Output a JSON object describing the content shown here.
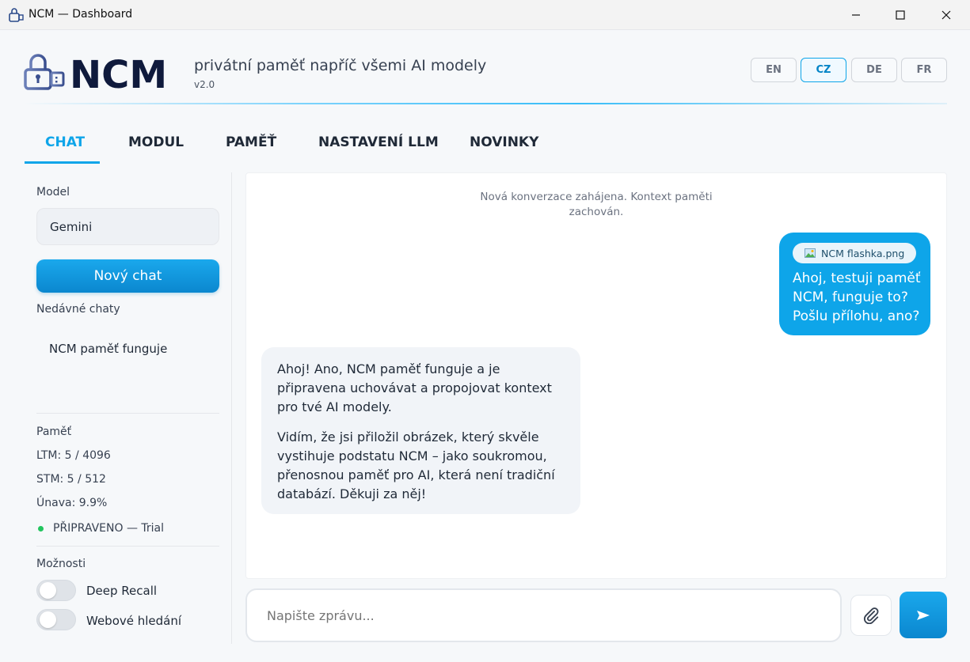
{
  "window": {
    "title": "NCM — Dashboard"
  },
  "header": {
    "logo_text": "NCM",
    "tagline": "privátní paměť napříč všemi AI modely",
    "version": "v2.0",
    "languages": [
      "EN",
      "CZ",
      "DE",
      "FR"
    ],
    "active_language": "CZ"
  },
  "tabs": [
    {
      "label": "CHAT",
      "active": true
    },
    {
      "label": "MODUL",
      "active": false
    },
    {
      "label": "PAMĚŤ",
      "active": false
    },
    {
      "label": "NASTAVENÍ LLM",
      "active": false
    },
    {
      "label": "NOVINKY",
      "active": false
    }
  ],
  "sidebar": {
    "model_label": "Model",
    "model_value": "Gemini",
    "new_chat_label": "Nový chat",
    "recent_label": "Nedávné chaty",
    "recent_items": [
      "NCM paměť funguje"
    ],
    "memory_label": "Paměť",
    "ltm": "LTM: 5 / 4096",
    "stm": "STM: 5 / 512",
    "fatigue": "Únava: 9.9%",
    "status": "PŘIPRAVENO — Trial",
    "options_label": "Možnosti",
    "toggles": [
      {
        "label": "Deep Recall",
        "on": false
      },
      {
        "label": "Webové hledání",
        "on": false
      }
    ]
  },
  "chat": {
    "system_note": "Nová konverzace zahájena. Kontext paměti zachován.",
    "user_message": {
      "attachment": "NCM flashka.png",
      "text": "Ahoj, testuji paměť NCM, funguje to? Pošlu přílohu, ano?"
    },
    "assistant_message": {
      "paragraph1": "Ahoj! Ano, NCM paměť funguje a je připravena uchovávat a propojovat kontext pro tvé AI modely.",
      "paragraph2": "Vidím, že jsi přiložil obrázek, který skvěle vystihuje podstatu NCM – jako soukromou, přenosnou paměť pro AI, která není tradiční databází. Děkuji za něj!"
    },
    "input_placeholder": "Napište zprávu..."
  },
  "colors": {
    "accent": "#0ea5e9",
    "logo_navy": "#0f1a3c",
    "status_green": "#22c55e"
  },
  "icons": [
    "lock-usb-icon",
    "minimize-icon",
    "maximize-icon",
    "close-icon",
    "image-icon",
    "paperclip-icon",
    "send-icon"
  ]
}
